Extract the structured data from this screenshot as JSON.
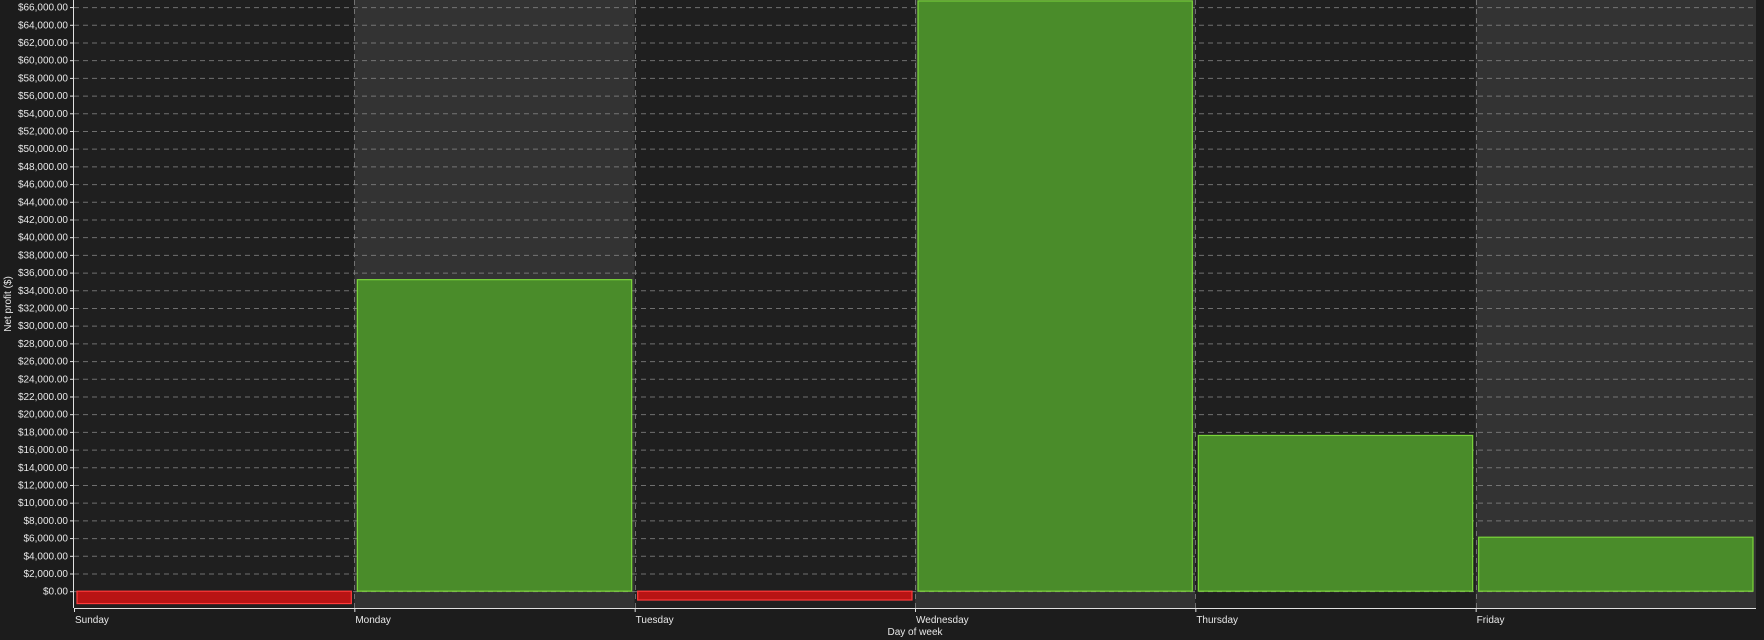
{
  "chart_data": {
    "type": "bar",
    "title": "",
    "xlabel": "Day of week",
    "ylabel": "Net profit ($)",
    "categories": [
      "Sunday",
      "Monday",
      "Tuesday",
      "Wednesday",
      "Thursday",
      "Friday"
    ],
    "values": [
      -1400,
      35200,
      -1000,
      66700,
      17600,
      6100
    ],
    "ylim": [
      -1900,
      66800
    ],
    "yticks": [
      0,
      2000,
      4000,
      6000,
      8000,
      10000,
      12000,
      14000,
      16000,
      18000,
      20000,
      22000,
      24000,
      26000,
      28000,
      30000,
      32000,
      34000,
      36000,
      38000,
      40000,
      42000,
      44000,
      46000,
      48000,
      50000,
      52000,
      54000,
      56000,
      58000,
      60000,
      62000,
      64000,
      66000
    ],
    "ytick_labels": [
      "$0.00",
      "$2,000.00",
      "$4,000.00",
      "$6,000.00",
      "$8,000.00",
      "$10,000.00",
      "$12,000.00",
      "$14,000.00",
      "$16,000.00",
      "$18,000.00",
      "$20,000.00",
      "$22,000.00",
      "$24,000.00",
      "$26,000.00",
      "$28,000.00",
      "$30,000.00",
      "$32,000.00",
      "$34,000.00",
      "$36,000.00",
      "$38,000.00",
      "$40,000.00",
      "$42,000.00",
      "$44,000.00",
      "$46,000.00",
      "$48,000.00",
      "$50,000.00",
      "$52,000.00",
      "$54,000.00",
      "$56,000.00",
      "$58,000.00",
      "$60,000.00",
      "$62,000.00",
      "$64,000.00",
      "$66,000.00"
    ],
    "grid": true,
    "legend": "none",
    "colors": {
      "positive_fill": "#4a8c2a",
      "positive_stroke": "#7bd63a",
      "negative_fill": "#b81414",
      "negative_stroke": "#ff3b3b",
      "band_dark": "#1f1f1f",
      "band_light": "#333333",
      "grid": "#8a8a8a",
      "axis": "#e0e0e0",
      "text": "#e8e8e8"
    }
  }
}
